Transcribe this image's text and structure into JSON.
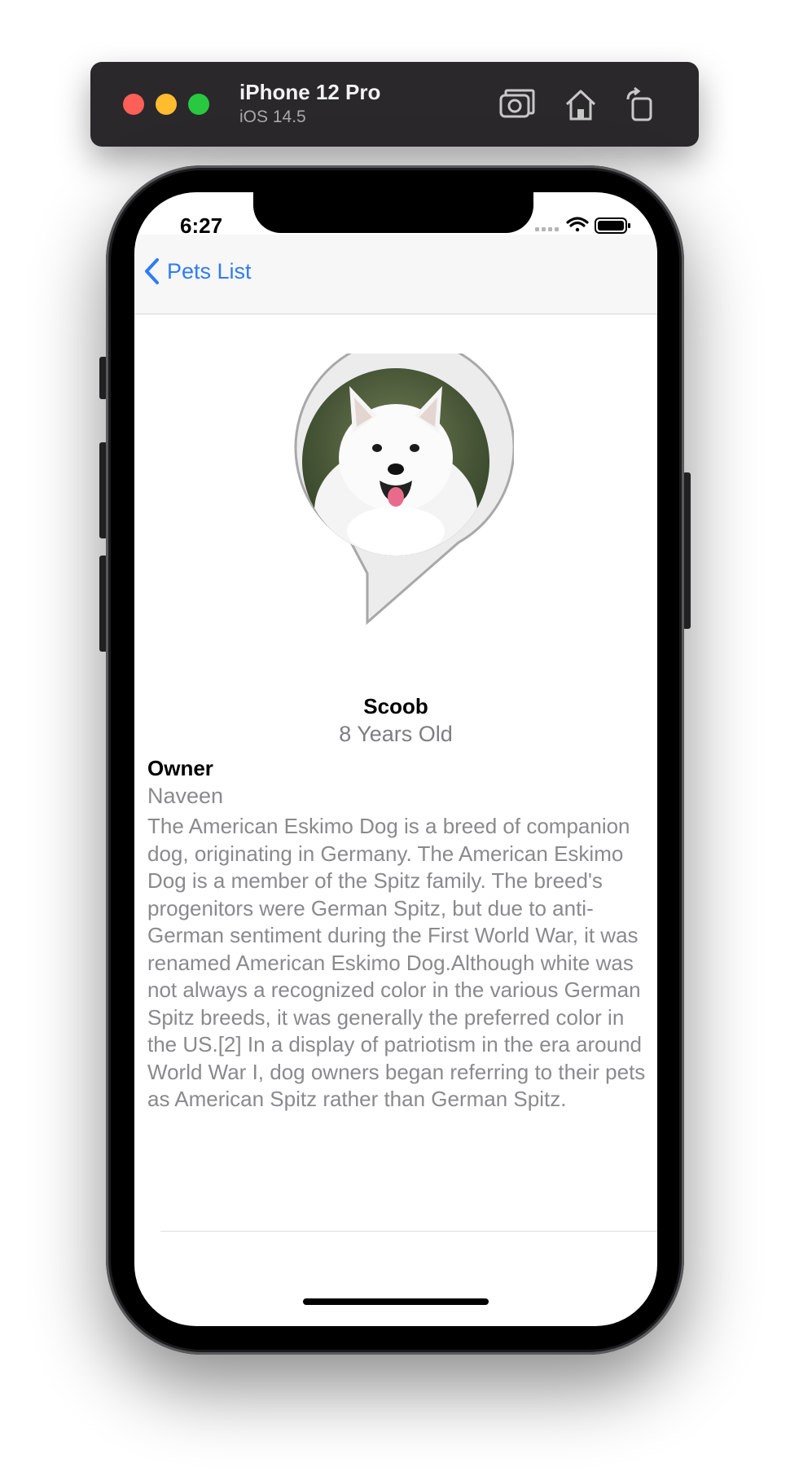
{
  "simulator": {
    "device_name": "iPhone 12 Pro",
    "os_version": "iOS 14.5",
    "icons": [
      "screenshot-icon",
      "home-icon",
      "rotate-icon"
    ]
  },
  "status_bar": {
    "time": "6:27"
  },
  "nav": {
    "back_label": "Pets List",
    "accent_color": "#2f7cf6"
  },
  "pet": {
    "name": "Scoob",
    "age": "8 Years Old",
    "owner_label": "Owner",
    "owner_name": "Naveen",
    "description": "The American Eskimo Dog is a breed of companion dog, originating in Germany. The American Eskimo Dog is a member of the Spitz family. The breed's progenitors were German Spitz, but due to anti-German sentiment during the First World War, it was renamed American Eskimo Dog.Although white was not always a recognized color in the various German Spitz breeds, it was generally the preferred color in the US.[2] In a display of patriotism in the era around World War I, dog owners began referring to their pets as American Spitz rather than German Spitz."
  }
}
